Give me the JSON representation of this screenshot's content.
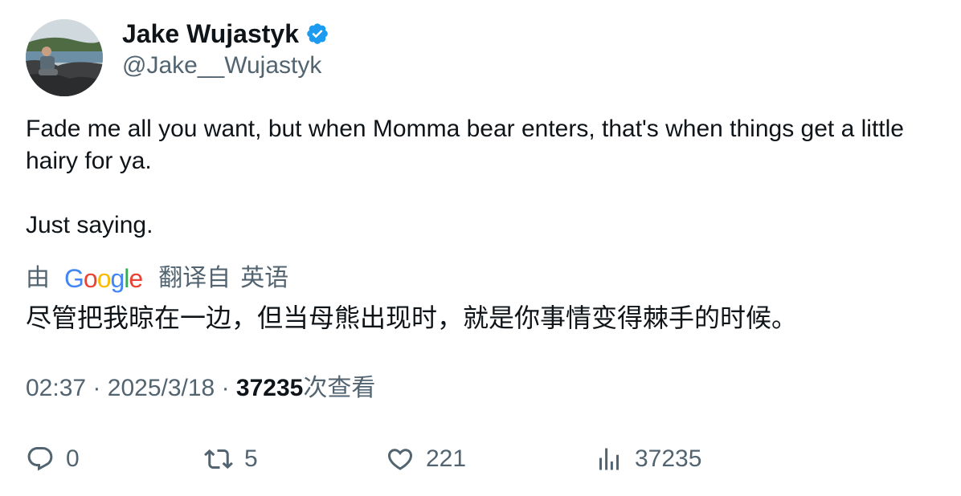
{
  "author": {
    "display_name": "Jake Wujastyk",
    "handle": "@Jake__Wujastyk",
    "verified": true,
    "verified_color": "#1d9bf0"
  },
  "tweet": {
    "paragraphs": [
      "Fade me all you want, but when Momma bear enters, that's when things get a little hairy for ya.",
      "Just saying."
    ]
  },
  "translation": {
    "by_label": "由",
    "provider": "Google",
    "from_label": "翻译自",
    "language": "英语",
    "text": "尽管把我晾在一边，但当母熊出现时，就是你事情变得棘手的时候。"
  },
  "meta": {
    "time": "02:37",
    "separator": "·",
    "date": "2025/3/18",
    "views_count": "37235",
    "views_label": "次查看"
  },
  "actions": {
    "replies": "0",
    "reposts": "5",
    "likes": "221",
    "views": "37235"
  },
  "colors": {
    "text_primary": "#0f1419",
    "text_secondary": "#536471",
    "accent": "#1d9bf0"
  }
}
